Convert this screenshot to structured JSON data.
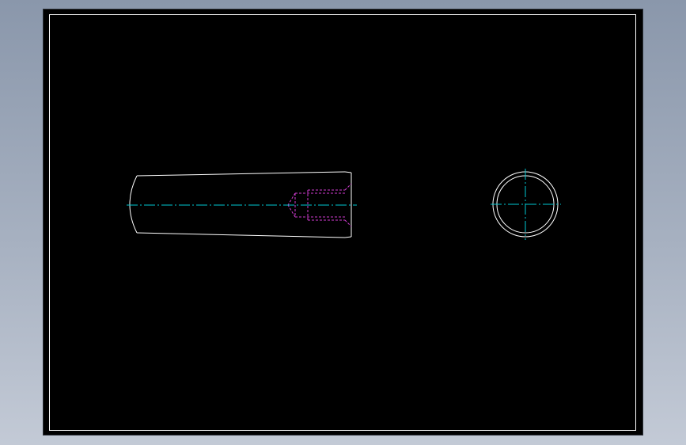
{
  "colors": {
    "sheet_background": "#000000",
    "border_line": "#ffffff",
    "outline_line": "#ffffff",
    "center_line": "#00c8d2",
    "hidden_line": "#d23cd2"
  },
  "views": {
    "front_view": "pin-side-view",
    "end_view": "pin-end-view"
  }
}
